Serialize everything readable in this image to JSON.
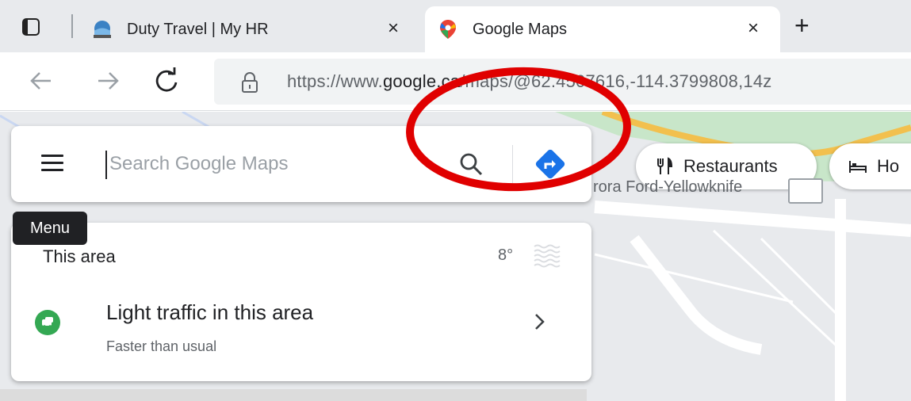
{
  "browser": {
    "tabs": [
      {
        "title": "Duty Travel | My HR",
        "close": "×"
      },
      {
        "title": "Google Maps",
        "close": "×"
      }
    ],
    "new_tab": "+",
    "nav": {
      "back": "←",
      "forward": "→",
      "reload": "C"
    },
    "url": {
      "prefix": "https://www.",
      "domain": "google.ca",
      "path": "/maps/@62.4507616,-114.3799808,14z"
    }
  },
  "maps": {
    "search": {
      "placeholder": "Search Google Maps",
      "value": ""
    },
    "chips": [
      {
        "label": "Restaurants"
      },
      {
        "label": "Ho"
      }
    ],
    "place_label": "rora Ford-Yellowknife",
    "tooltip": "Menu",
    "card": {
      "title": "This area",
      "temperature": "8°",
      "traffic": {
        "title": "Light traffic in this area",
        "subtitle": "Faster than usual"
      }
    }
  },
  "icons": {
    "tab_actions": "tab-actions-icon",
    "tab1_favicon": "myhr-favicon-icon",
    "tab2_favicon": "google-maps-pin-icon",
    "lock": "lock-icon",
    "menu": "hamburger-icon",
    "search": "search-icon",
    "directions": "directions-icon",
    "restaurants": "fork-knife-icon",
    "hotels": "bed-icon",
    "weather": "fog-icon",
    "traffic": "car-icon",
    "chevron": "chevron-right-icon"
  },
  "colors": {
    "directions_blue": "#1a73e8",
    "traffic_green": "#34a853",
    "annotation_red": "#e00000",
    "maps_pin_red": "#ea4335"
  }
}
